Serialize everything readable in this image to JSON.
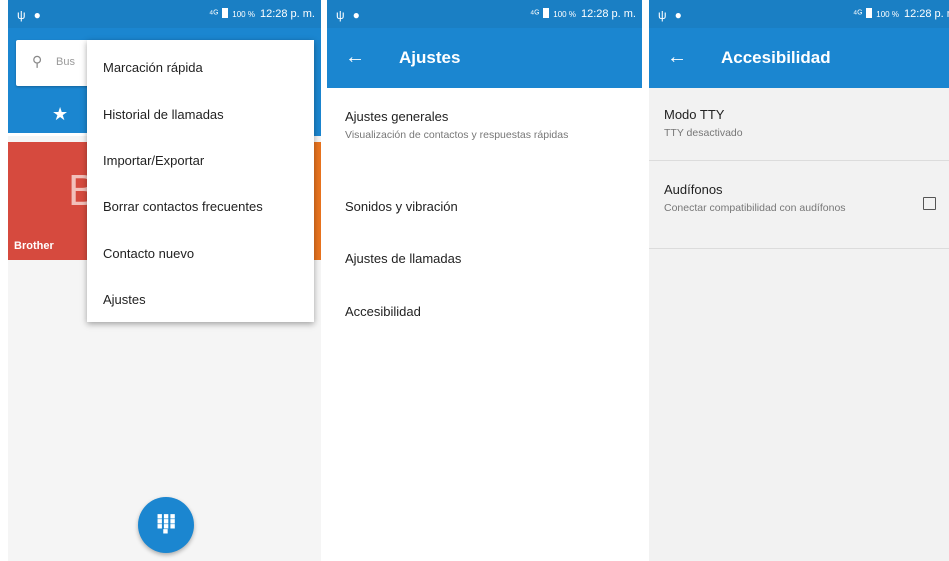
{
  "status_bar": {
    "signal": "⁴ᴳ",
    "battery": "100 %",
    "time": "12:28 p. m."
  },
  "screen1": {
    "search_placeholder": "Bus",
    "contact_name": "Brother",
    "contact_letter": "B",
    "menu": [
      "Marcación rápida",
      "Historial de llamadas",
      "Importar/Exportar",
      "Borrar contactos frecuentes",
      "Contacto nuevo",
      "Ajustes"
    ]
  },
  "screen2": {
    "title": "Ajustes",
    "items": [
      {
        "title": "Ajustes generales",
        "subtitle": "Visualización de contactos y respuestas rápidas"
      },
      {
        "title": "Sonidos y vibración"
      },
      {
        "title": "Ajustes de llamadas"
      },
      {
        "title": "Accesibilidad"
      }
    ]
  },
  "screen3": {
    "title": "Accesibilidad",
    "items": [
      {
        "title": "Modo TTY",
        "subtitle": "TTY desactivado"
      },
      {
        "title": "Audífonos",
        "subtitle": "Conectar compatibilidad con audífonos"
      }
    ]
  },
  "colors": {
    "primary": "#1b86d0",
    "status_bar": "#1a7fc4",
    "card_red": "#d64a3e",
    "card_orange": "#e8731f"
  },
  "icons": {
    "back": "arrow-left-icon",
    "search": "search-icon",
    "favorites": "star-icon",
    "dialpad": "dialpad-icon"
  }
}
